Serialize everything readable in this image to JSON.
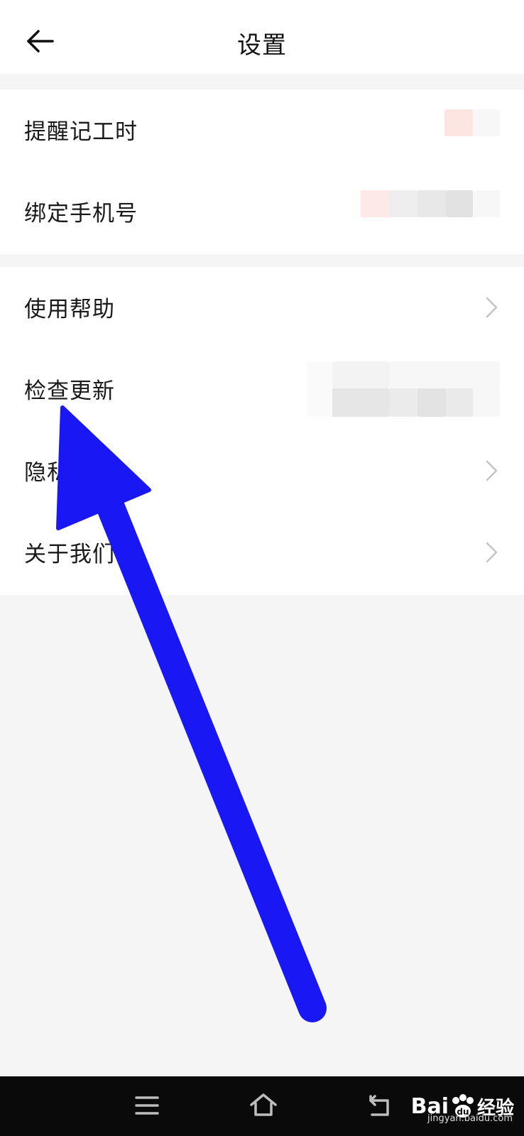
{
  "header": {
    "title": "设置"
  },
  "groups": [
    {
      "items": [
        {
          "label": "提醒记工时"
        },
        {
          "label": "绑定手机号"
        }
      ]
    },
    {
      "items": [
        {
          "label": "使用帮助"
        },
        {
          "label": "检查更新"
        },
        {
          "label": "隐私"
        },
        {
          "label": "关于我们"
        }
      ]
    }
  ],
  "navbar": {
    "icons": [
      "menu-icon",
      "home-icon",
      "back-icon"
    ]
  },
  "watermark": {
    "brand": "Bai",
    "brand_suffix": "经验",
    "url": "jingyan.baidu.com"
  },
  "colors": {
    "annotation_arrow": "#1a17f5",
    "chevron": "#c4c4c4",
    "background": "#f5f5f5"
  }
}
